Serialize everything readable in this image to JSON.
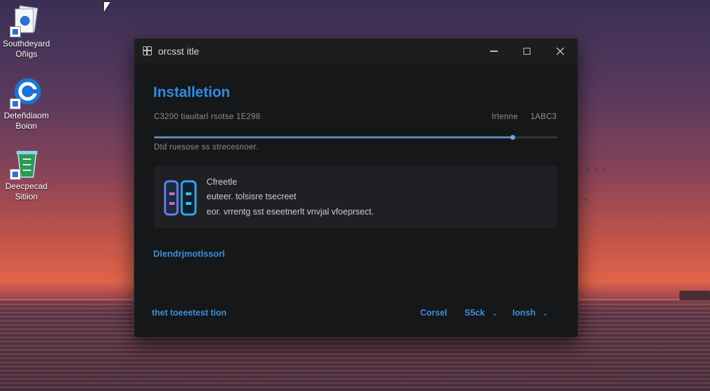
{
  "desktop": {
    "icons": [
      {
        "label_line1": "Southdeyard",
        "label_line2": "Oñigs"
      },
      {
        "label_line1": "Deteñdiaom",
        "label_line2": "Boion"
      },
      {
        "label_line1": "Deecpecad",
        "label_line2": "Sitiion"
      }
    ]
  },
  "window": {
    "title": "orcsst itle",
    "heading": "Installetion",
    "status_left": "C3200  tiauitarl rsotse 1E298",
    "status_right_1": "Irtenne",
    "status_right_2": "1ABC3",
    "progress_percent": 89,
    "progress_detail": "Dtd ruesose ss strecesnoer.",
    "card": {
      "line1": "Cfreetle",
      "line2": "euteer. tolsisre   tsecreet",
      "line3": "eor. vrrentg sst eseetnerlt   vnvjal vfoeprsect."
    },
    "details_link": "Dlendrjmotlssorl",
    "footer_link": "thet toeeetest tion",
    "buttons": {
      "cancel": "Corsel",
      "back": "S5ck",
      "install": "Ionsh"
    }
  }
}
